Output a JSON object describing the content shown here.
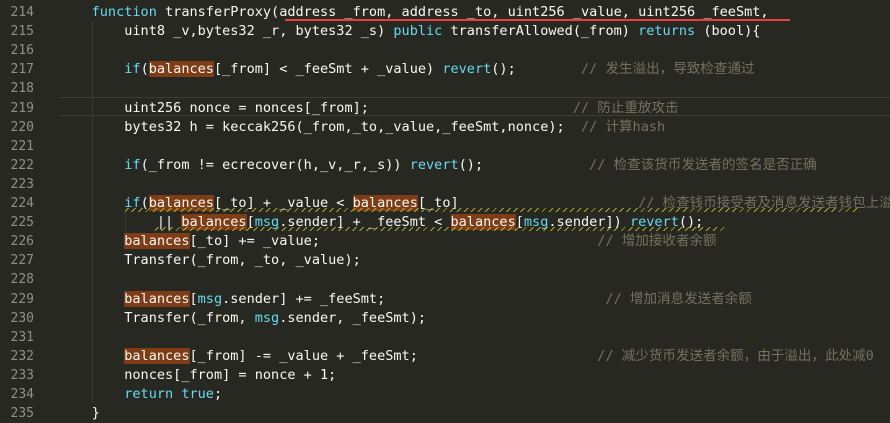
{
  "editor": {
    "lines": [
      {
        "num": "214",
        "segs": [
          [
            "",
            "    "
          ],
          [
            "kw",
            "function"
          ],
          [
            "",
            " transferProxy(address _from, address _to, uint256 _value, uint256 _feeSmt,"
          ]
        ]
      },
      {
        "num": "215",
        "segs": [
          [
            "",
            "        uint8 _v,bytes32 _r, bytes32 _s) "
          ],
          [
            "kw",
            "public"
          ],
          [
            "",
            " transferAllowed(_from) "
          ],
          [
            "kw",
            "returns"
          ],
          [
            "",
            " (bool){"
          ]
        ]
      },
      {
        "num": "216",
        "segs": []
      },
      {
        "num": "217",
        "segs": [
          [
            "",
            "        "
          ],
          [
            "kw",
            "if"
          ],
          [
            "",
            "("
          ],
          [
            "hl",
            "balances"
          ],
          [
            "",
            "[_from] < _feeSmt + _value) "
          ],
          [
            "kw",
            "revert"
          ],
          [
            "",
            "();        "
          ],
          [
            "cm",
            "// 发生溢出，导致检查通过"
          ]
        ]
      },
      {
        "num": "218",
        "segs": []
      },
      {
        "num": "219",
        "segs": [
          [
            "",
            "        uint256 nonce = nonces[_from];                         "
          ],
          [
            "cm",
            "// 防止重放攻击"
          ]
        ]
      },
      {
        "num": "220",
        "segs": [
          [
            "",
            "        bytes32 h = keccak256(_from,_to,_value,_feeSmt,nonce);  "
          ],
          [
            "cm",
            "// 计算hash"
          ]
        ]
      },
      {
        "num": "221",
        "segs": []
      },
      {
        "num": "222",
        "segs": [
          [
            "",
            "        "
          ],
          [
            "kw",
            "if"
          ],
          [
            "",
            "(_from != ecrecover(h,_v,_r,_s)) "
          ],
          [
            "kw",
            "revert"
          ],
          [
            "",
            "();             "
          ],
          [
            "cm",
            "// 检查该货币发送者的签名是否正确"
          ]
        ]
      },
      {
        "num": "223",
        "segs": []
      },
      {
        "num": "224",
        "segs": [
          [
            "",
            "        "
          ],
          [
            "kw",
            "if"
          ],
          [
            "",
            "("
          ],
          [
            "hl",
            "balances"
          ],
          [
            "",
            "[_to] + _value < "
          ],
          [
            "hl",
            "balances"
          ],
          [
            "",
            "[_to]                      "
          ],
          [
            "cm",
            "// 检查钱币接受者及消息发送者钱包上溢"
          ]
        ]
      },
      {
        "num": "225",
        "segs": [
          [
            "",
            "            || "
          ],
          [
            "hl",
            "balances"
          ],
          [
            "",
            "["
          ],
          [
            "kw",
            "msg"
          ],
          [
            "",
            ".sender] + _feeSmt < "
          ],
          [
            "hl",
            "balances"
          ],
          [
            "",
            "["
          ],
          [
            "kw",
            "msg"
          ],
          [
            "",
            ".sender]) "
          ],
          [
            "kw",
            "revert"
          ],
          [
            "",
            "();"
          ]
        ]
      },
      {
        "num": "226",
        "segs": [
          [
            "",
            "        "
          ],
          [
            "hl",
            "balances"
          ],
          [
            "",
            "[_to] += _value;                                  "
          ],
          [
            "cm",
            "// 增加接收者余额"
          ]
        ]
      },
      {
        "num": "227",
        "segs": [
          [
            "",
            "        Transfer(_from, _to, _value);"
          ]
        ]
      },
      {
        "num": "228",
        "segs": []
      },
      {
        "num": "229",
        "segs": [
          [
            "",
            "        "
          ],
          [
            "hl",
            "balances"
          ],
          [
            "",
            "["
          ],
          [
            "kw",
            "msg"
          ],
          [
            "",
            ".sender] += _feeSmt;                           "
          ],
          [
            "cm",
            "// 增加消息发送者余额"
          ]
        ]
      },
      {
        "num": "230",
        "segs": [
          [
            "",
            "        Transfer(_from, "
          ],
          [
            "kw",
            "msg"
          ],
          [
            "",
            ".sender, _feeSmt);"
          ]
        ]
      },
      {
        "num": "231",
        "segs": []
      },
      {
        "num": "232",
        "segs": [
          [
            "",
            "        "
          ],
          [
            "hl",
            "balances"
          ],
          [
            "",
            "[_from] -= _value + _feeSmt;                      "
          ],
          [
            "cm",
            "// 减少货币发送者余额，由于溢出，此处减0"
          ]
        ]
      },
      {
        "num": "233",
        "segs": [
          [
            "",
            "        nonces[_from] = nonce + 1;"
          ]
        ]
      },
      {
        "num": "234",
        "segs": [
          [
            "",
            "        "
          ],
          [
            "kw",
            "return"
          ],
          [
            "",
            " "
          ],
          [
            "kw",
            "true"
          ],
          [
            "",
            ";"
          ]
        ]
      },
      {
        "num": "235",
        "segs": [
          [
            "",
            "    }"
          ]
        ]
      }
    ]
  },
  "colors": {
    "background": "#272822",
    "keyword": "#66d9ef",
    "comment": "#75715e",
    "highlight": "#7e3d16",
    "text": "#f8f8f2",
    "line_number": "#90908a"
  }
}
